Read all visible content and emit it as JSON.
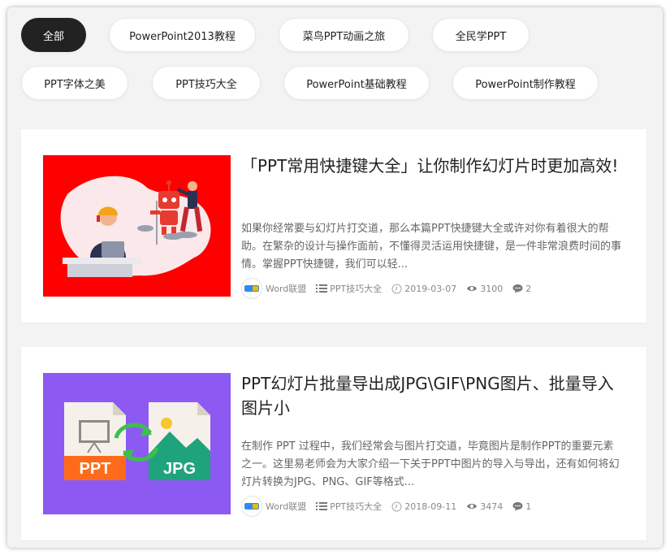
{
  "tags": [
    {
      "label": "全部",
      "active": true
    },
    {
      "label": "PowerPoint2013教程"
    },
    {
      "label": "菜鸟PPT动画之旅"
    },
    {
      "label": "全民学PPT"
    },
    {
      "label": "PPT字体之美"
    },
    {
      "label": "PPT技巧大全"
    },
    {
      "label": "PowerPoint基础教程"
    },
    {
      "label": "PowerPoint制作教程"
    }
  ],
  "posts": [
    {
      "title": "「PPT常用快捷键大全」让你制作幻灯片时更加高效!",
      "excerpt": "如果你经常要与幻灯片打交道，那么本篇PPT快捷键大全或许对你有着很大的帮助。在繁杂的设计与操作面前，不懂得灵活运用快捷键，是一件非常浪费时间的事情。掌握PPT快捷键，我们可以轻...",
      "author": "Word联盟",
      "category": "PPT技巧大全",
      "date": "2019-03-07",
      "views": "3100",
      "comments": "2",
      "thumb_bg": "#ff0000"
    },
    {
      "title": "PPT幻灯片批量导出成JPG\\GIF\\PNG图片、批量导入图片小",
      "excerpt": "在制作 PPT 过程中，我们经常会与图片打交道，毕竟图片是制作PPT的重要元素之一。这里易老师会为大家介绍一下关于PPT中图片的导入与导出，还有如何将幻灯片转换为JPG、PNG、GIF等格式...",
      "author": "Word联盟",
      "category": "PPT技巧大全",
      "date": "2018-09-11",
      "views": "3474",
      "comments": "1",
      "thumb_bg": "#8c5af2",
      "thumb_labels": {
        "left": "PPT",
        "right": "JPG"
      }
    }
  ],
  "icons": {
    "avatar": "word-lianmeng-logo",
    "category": "list-icon",
    "date": "clock-icon",
    "views": "eye-icon",
    "comments": "comment-icon"
  },
  "colors": {
    "active_tag": "#222222",
    "page_bg": "#f3f3f3",
    "card_bg": "#ffffff"
  }
}
